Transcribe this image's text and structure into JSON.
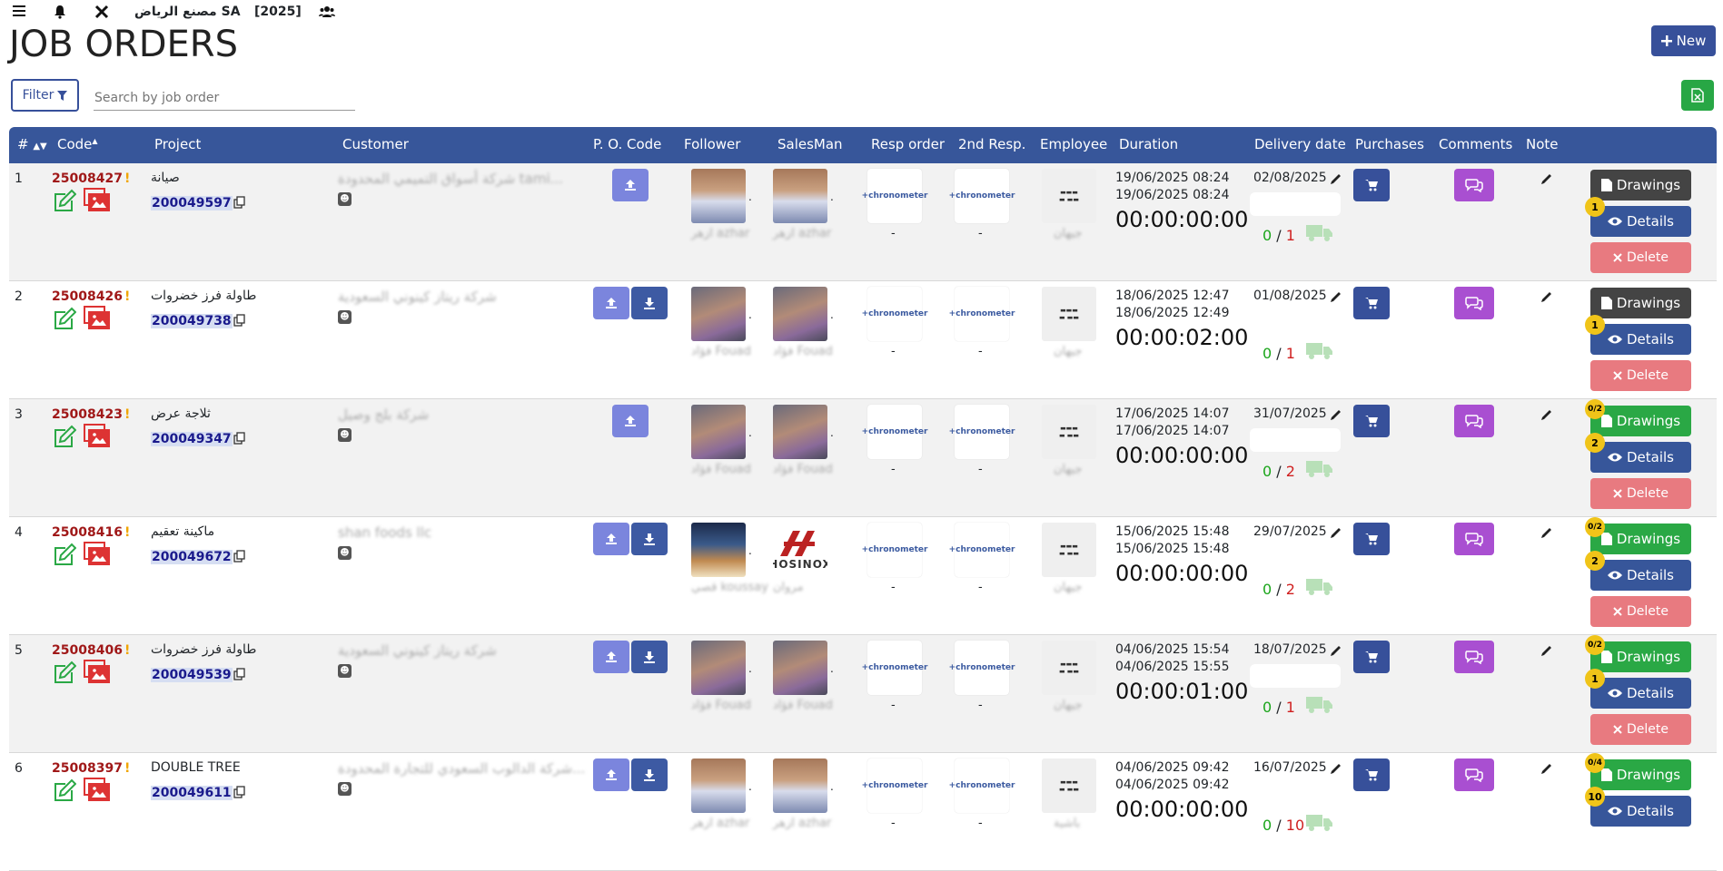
{
  "topbar": {
    "company": "مصنع الرياض SA",
    "year": "[2025]"
  },
  "page": {
    "title": "JOB ORDERS"
  },
  "toolbar": {
    "new_label": "New",
    "filter_label": "Filter",
    "search_placeholder": "Search by job order"
  },
  "icons": {
    "menu": "menu-icon",
    "bell": "bell-icon",
    "tools": "tools-icon",
    "users": "users-icon",
    "plus": "plus-icon",
    "funnel": "funnel-icon",
    "excel": "excel-icon",
    "upload": "upload-icon",
    "download": "download-icon",
    "cart": "cart-icon",
    "comments": "comments-icon",
    "pencil": "pencil-icon",
    "truck": "truck-icon",
    "file": "file-icon",
    "eye": "eye-icon",
    "times": "times-icon",
    "copy": "copy-icon",
    "edit": "edit-icon",
    "images": "images-icon"
  },
  "columns": {
    "num": "#",
    "code": "Code",
    "project": "Project",
    "customer": "Customer",
    "po": "P. O. Code",
    "follower": "Follower",
    "salesman": "SalesMan",
    "resp": "Resp order",
    "resp2": "2nd Resp.",
    "employee": "Employee",
    "duration": "Duration",
    "delivery": "Delivery date",
    "purchases": "Purchases",
    "comments": "Comments",
    "note": "Note"
  },
  "row_labels": {
    "drawings": "Drawings",
    "details": "Details",
    "delete": "Delete",
    "chrono": "+chronometer",
    "dash": "-",
    "sep": "/"
  },
  "rows": [
    {
      "num": "1",
      "code": "25008427",
      "project": "صيانة",
      "job": "200049597",
      "customer": "شركة أسواق التميمي المحدودة tami...",
      "download": false,
      "follower": "ازهر azhar",
      "follower_type": "a",
      "salesman": "ازهر azhar",
      "salesman_type": "a",
      "employee": "جيهان",
      "start": "19/06/2025  08:24",
      "end": "19/06/2025  08:24",
      "duration": "00:00:00:00",
      "delivery": "02/08/2025",
      "done": "0",
      "total": "1",
      "drawings_green": false,
      "draw_badge": "",
      "det_badge": "1",
      "has_delete": true
    },
    {
      "num": "2",
      "code": "25008426",
      "project": "طاولة فرز خضروات",
      "job": "200049738",
      "customer": "شركة ريتاز كينوني السعودية",
      "download": true,
      "follower": "فؤاد Fouad",
      "follower_type": "f",
      "salesman": "فؤاد Fouad",
      "salesman_type": "f",
      "employee": "جيهان",
      "start": "18/06/2025  12:47",
      "end": "18/06/2025  12:49",
      "duration": "00:00:02:00",
      "delivery": "01/08/2025",
      "done": "0",
      "total": "1",
      "drawings_green": false,
      "draw_badge": "",
      "det_badge": "1",
      "has_delete": true
    },
    {
      "num": "3",
      "code": "25008423",
      "project": "ثلاجة عرض",
      "job": "200049347",
      "customer": "شركة بلج وصيل",
      "download": false,
      "follower": "فؤاد Fouad",
      "follower_type": "f",
      "salesman": "فؤاد Fouad",
      "salesman_type": "f",
      "employee": "جيهان",
      "start": "17/06/2025  14:07",
      "end": "17/06/2025  14:07",
      "duration": "00:00:00:00",
      "delivery": "31/07/2025",
      "done": "0",
      "total": "2",
      "drawings_green": true,
      "draw_badge": "0/2",
      "det_badge": "2",
      "has_delete": true
    },
    {
      "num": "4",
      "code": "25008416",
      "project": "ماكينة تعقيم",
      "job": "200049672",
      "customer": "shan foods llc",
      "download": true,
      "follower": "قصي koussay",
      "follower_type": "k",
      "salesman": "مروان",
      "salesman_type": "hosinox",
      "hosinox": "HOSINOX",
      "employee": "جيهان",
      "start": "15/06/2025  15:48",
      "end": "15/06/2025  15:48",
      "duration": "00:00:00:00",
      "delivery": "29/07/2025",
      "done": "0",
      "total": "2",
      "drawings_green": true,
      "draw_badge": "0/2",
      "det_badge": "2",
      "has_delete": true
    },
    {
      "num": "5",
      "code": "25008406",
      "project": "طاولة فرز خضروات",
      "job": "200049539",
      "customer": "شركة ريتاز كينوني السعودية",
      "download": true,
      "follower": "فؤاد Fouad",
      "follower_type": "f",
      "salesman": "فؤاد Fouad",
      "salesman_type": "f",
      "employee": "جيهان",
      "start": "04/06/2025  15:54",
      "end": "04/06/2025  15:55",
      "duration": "00:00:01:00",
      "delivery": "18/07/2025",
      "done": "0",
      "total": "1",
      "drawings_green": true,
      "draw_badge": "0/2",
      "det_badge": "1",
      "has_delete": true
    },
    {
      "num": "6",
      "code": "25008397",
      "project": "DOUBLE TREE",
      "job": "200049611",
      "customer": "شركة الدالوب السعودي للتجارة المحدودة...",
      "download": true,
      "follower": "ازهر azhar",
      "follower_type": "a",
      "salesman": "ازهر azhar",
      "salesman_type": "a",
      "employee": "باشية",
      "start": "04/06/2025  09:42",
      "end": "04/06/2025  09:42",
      "duration": "00:00:00:00",
      "delivery": "16/07/2025",
      "done": "0",
      "total": "10",
      "drawings_green": true,
      "draw_badge": "0/4",
      "det_badge": "10",
      "has_delete": false
    }
  ]
}
